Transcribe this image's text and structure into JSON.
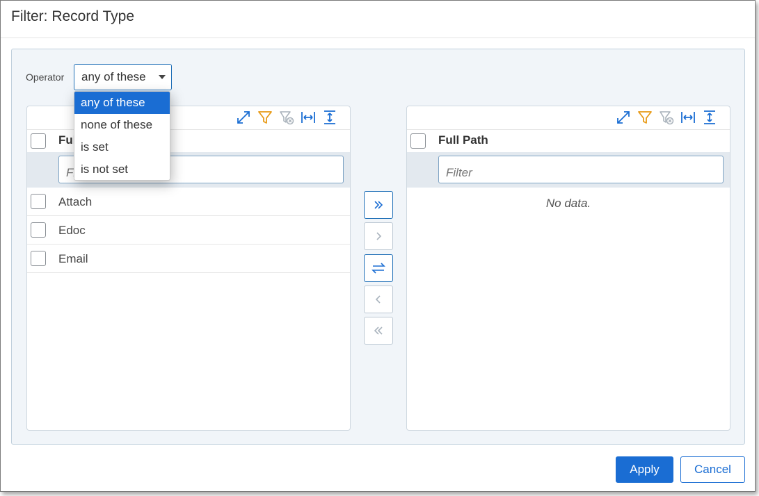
{
  "dialog": {
    "title": "Filter: Record Type"
  },
  "operator": {
    "label": "Operator",
    "selected": "any of these",
    "options": [
      "any of these",
      "none of these",
      "is set",
      "is not set"
    ]
  },
  "left_list": {
    "header": "Full Path",
    "filter_placeholder": "Filter",
    "rows": [
      {
        "label": "Attach"
      },
      {
        "label": "Edoc"
      },
      {
        "label": "Email"
      }
    ]
  },
  "right_list": {
    "header": "Full Path",
    "filter_placeholder": "Filter",
    "empty_text": "No data."
  },
  "toolbar_icons": [
    "expand-icon",
    "filter-icon",
    "clear-filter-icon",
    "fit-width-icon",
    "fit-height-icon"
  ],
  "move_buttons": [
    "move-all-right-icon",
    "move-right-icon",
    "swap-icon",
    "move-left-icon",
    "move-all-left-icon"
  ],
  "footer": {
    "apply_label": "Apply",
    "cancel_label": "Cancel"
  },
  "colors": {
    "accent": "#1a6dd3",
    "filter_icon": "#e89a16",
    "panel_bg": "#f1f5f9"
  }
}
